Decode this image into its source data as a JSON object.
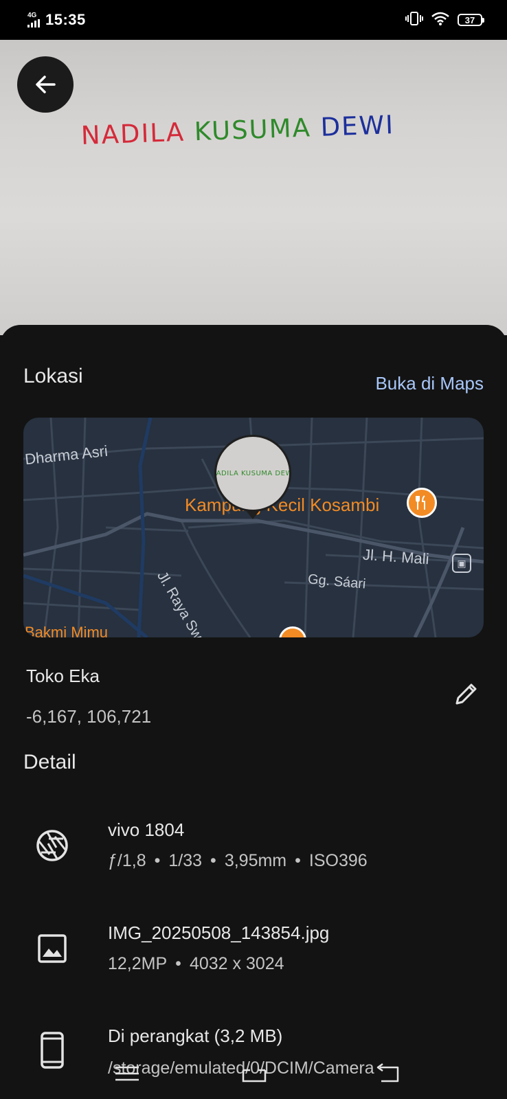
{
  "status_bar": {
    "network": "4G",
    "time": "15:35",
    "battery": "37"
  },
  "photo": {
    "caption_words": [
      "NADILA",
      "KUSUMA",
      "DEWI"
    ],
    "caption_colors": [
      "#d42a3a",
      "#2f8a2b",
      "#1c2f9c"
    ]
  },
  "location": {
    "section_title": "Lokasi",
    "open_maps_label": "Buka di Maps",
    "map_labels": {
      "area_1": "Dharma Asri",
      "poi": "Kampung Kecil Kosambi",
      "street_1": "Jl. H. Mali",
      "street_2": "Gg. Sáari",
      "street_3": "Jl. Raya Swadana",
      "poi_2": "Bakmi Mimu"
    },
    "pin_caption": "NADILA KUSUMA DEWI",
    "place_name": "Toko Eka",
    "coordinates": "-6,167, 106,721"
  },
  "detail": {
    "section_title": "Detail",
    "camera": {
      "model": "vivo 1804",
      "specs": [
        "ƒ/1,8",
        "1/33",
        "3,95mm",
        "ISO396"
      ]
    },
    "file": {
      "name": "IMG_20250508_143854.jpg",
      "specs": [
        "12,2MP",
        "4032 x 3024"
      ]
    },
    "storage": {
      "label": "Di perangkat (3,2 MB)",
      "path": "/storage/emulated/0/DCIM/Camera"
    }
  },
  "colors": {
    "accent_link": "#a8c7fa",
    "poi_orange": "#f28b24",
    "map_bg": "#27313f"
  }
}
